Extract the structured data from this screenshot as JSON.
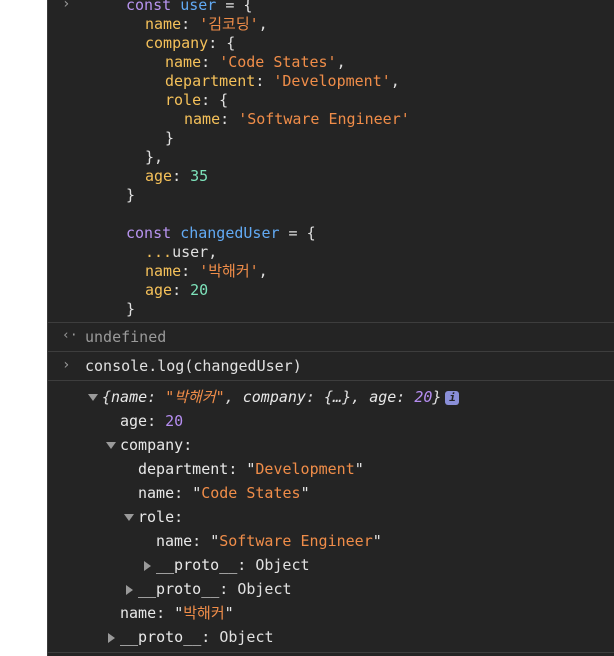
{
  "code": {
    "l1": {
      "kw": "const",
      "name": "user",
      "op": " = {"
    },
    "l2": {
      "key": "name",
      "colon": ": ",
      "val": "'김코딩'",
      "end": ","
    },
    "l3": {
      "key": "company",
      "rest": ": {"
    },
    "l4": {
      "key": "name",
      "colon": ": ",
      "val": "'Code States'",
      "end": ","
    },
    "l5": {
      "key": "department",
      "colon": ": ",
      "val": "'Development'",
      "end": ","
    },
    "l6": {
      "key": "role",
      "rest": ": {"
    },
    "l7": {
      "key": "name",
      "colon": ": ",
      "val": "'Software Engineer'"
    },
    "l8": "}",
    "l9": "},",
    "l10": {
      "key": "age",
      "colon": ": ",
      "val": "35"
    },
    "l11": "}",
    "l12": {
      "kw": "const",
      "name": "changedUser",
      "op": " = {"
    },
    "l13": {
      "spread": "...",
      "rest": "user,"
    },
    "l14": {
      "key": "name",
      "colon": ": ",
      "val": "'박해커'",
      "end": ","
    },
    "l15": {
      "key": "age",
      "colon": ": ",
      "val": "20"
    },
    "l16": "}"
  },
  "result": "undefined",
  "command": {
    "obj": "console",
    "dot": ".",
    "fn": "log",
    "args": "(changedUser)"
  },
  "tree": {
    "summary": {
      "open": "{",
      "k1": "name",
      "v1": "\"박해커\"",
      "k2": "company",
      "v2": "{…}",
      "k3": "age",
      "v3": "20",
      "close": "}",
      "badge": "i"
    },
    "age": {
      "key": "age",
      "val": "20"
    },
    "company": {
      "key": "company"
    },
    "department": {
      "key": "department",
      "val": "Development"
    },
    "cname": {
      "key": "name",
      "val": "Code States"
    },
    "role": {
      "key": "role"
    },
    "rname": {
      "key": "name",
      "val": "Software Engineer"
    },
    "proto": "__proto__",
    "proto_val": "Object",
    "name": {
      "key": "name",
      "val": "박해커"
    }
  },
  "colors": {
    "background": "#242424",
    "keyword": "#b894f0",
    "variable": "#62aaf4",
    "property": "#f5c15a",
    "string": "#f08d49",
    "number": "#7ee3bb"
  }
}
